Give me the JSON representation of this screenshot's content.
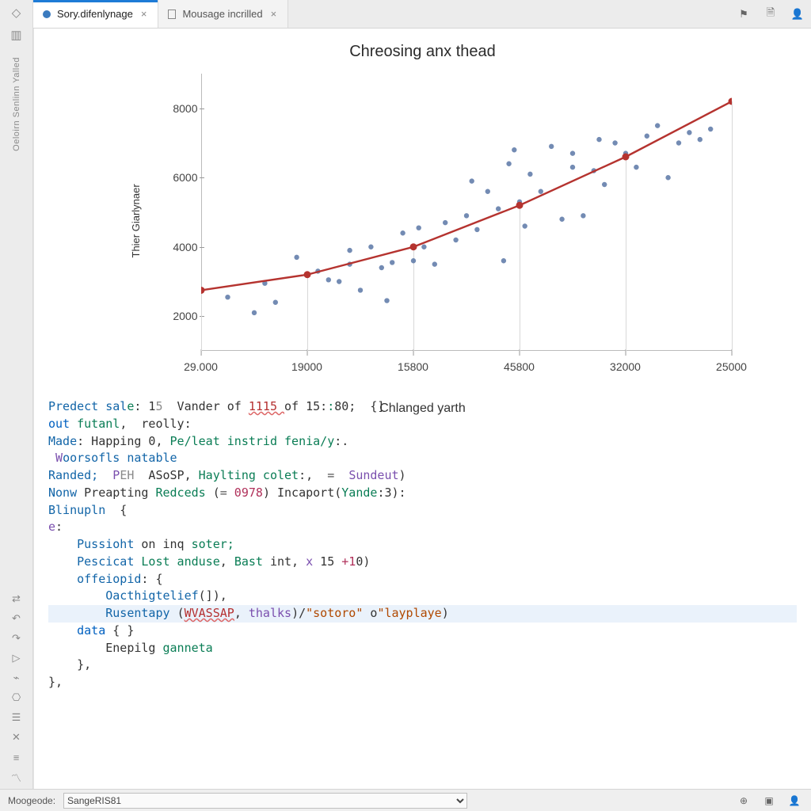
{
  "tabs": [
    {
      "label": "Sory.difenlynage",
      "icon": "dot",
      "active": true
    },
    {
      "label": "Mousage incrilled",
      "icon": "doc",
      "active": false
    }
  ],
  "toolbar_icons": [
    "pin-icon",
    "new-file-icon",
    "user-icon"
  ],
  "gutter": {
    "top_icons": [
      "diamond-icon",
      "layout-icon"
    ],
    "vertical_label": "Oeloirn Senlinn Yalled",
    "bottom_icons": [
      "swap-icon",
      "undo-icon",
      "redo-icon",
      "play-icon",
      "brackets-icon",
      "code-icon",
      "db-icon",
      "close-icon",
      "list-icon",
      "chart-icon",
      "grid-icon"
    ]
  },
  "chart_data": {
    "type": "scatter",
    "title": "Chreosing anx thead",
    "xlabel": "Chlanged yarth",
    "ylabel": "Thier Giarlynaer",
    "ylim": [
      1000,
      9000
    ],
    "yticks": [
      2000,
      4000,
      6000,
      8000
    ],
    "x_categories": [
      "29.000",
      "19000",
      "15800",
      "45800",
      "32000",
      "25000"
    ],
    "series": [
      {
        "name": "scatter",
        "color": "#5b77a6",
        "points": [
          {
            "xi": 0.05,
            "y": 2550
          },
          {
            "xi": 0.1,
            "y": 2100
          },
          {
            "xi": 0.12,
            "y": 2950
          },
          {
            "xi": 0.14,
            "y": 2400
          },
          {
            "xi": 0.18,
            "y": 3700
          },
          {
            "xi": 0.22,
            "y": 3300
          },
          {
            "xi": 0.24,
            "y": 3050
          },
          {
            "xi": 0.26,
            "y": 3000
          },
          {
            "xi": 0.28,
            "y": 3500
          },
          {
            "xi": 0.28,
            "y": 3900
          },
          {
            "xi": 0.3,
            "y": 2750
          },
          {
            "xi": 0.32,
            "y": 4000
          },
          {
            "xi": 0.34,
            "y": 3400
          },
          {
            "xi": 0.35,
            "y": 2450
          },
          {
            "xi": 0.36,
            "y": 3550
          },
          {
            "xi": 0.38,
            "y": 4400
          },
          {
            "xi": 0.4,
            "y": 3600
          },
          {
            "xi": 0.41,
            "y": 4550
          },
          {
            "xi": 0.42,
            "y": 4000
          },
          {
            "xi": 0.44,
            "y": 3500
          },
          {
            "xi": 0.46,
            "y": 4700
          },
          {
            "xi": 0.48,
            "y": 4200
          },
          {
            "xi": 0.5,
            "y": 4900
          },
          {
            "xi": 0.51,
            "y": 5900
          },
          {
            "xi": 0.52,
            "y": 4500
          },
          {
            "xi": 0.54,
            "y": 5600
          },
          {
            "xi": 0.56,
            "y": 5100
          },
          {
            "xi": 0.57,
            "y": 3600
          },
          {
            "xi": 0.58,
            "y": 6400
          },
          {
            "xi": 0.59,
            "y": 6800
          },
          {
            "xi": 0.6,
            "y": 5300
          },
          {
            "xi": 0.61,
            "y": 4600
          },
          {
            "xi": 0.62,
            "y": 6100
          },
          {
            "xi": 0.64,
            "y": 5600
          },
          {
            "xi": 0.66,
            "y": 6900
          },
          {
            "xi": 0.68,
            "y": 4800
          },
          {
            "xi": 0.7,
            "y": 6300
          },
          {
            "xi": 0.7,
            "y": 6700
          },
          {
            "xi": 0.72,
            "y": 4900
          },
          {
            "xi": 0.74,
            "y": 6200
          },
          {
            "xi": 0.75,
            "y": 7100
          },
          {
            "xi": 0.76,
            "y": 5800
          },
          {
            "xi": 0.78,
            "y": 7000
          },
          {
            "xi": 0.8,
            "y": 6700
          },
          {
            "xi": 0.82,
            "y": 6300
          },
          {
            "xi": 0.84,
            "y": 7200
          },
          {
            "xi": 0.86,
            "y": 7500
          },
          {
            "xi": 0.88,
            "y": 6000
          },
          {
            "xi": 0.9,
            "y": 7000
          },
          {
            "xi": 0.92,
            "y": 7300
          },
          {
            "xi": 0.94,
            "y": 7100
          },
          {
            "xi": 0.96,
            "y": 7400
          }
        ]
      },
      {
        "name": "fit",
        "color": "#b5332f",
        "line": [
          {
            "xi": 0.0,
            "y": 2750
          },
          {
            "xi": 0.2,
            "y": 3200
          },
          {
            "xi": 0.4,
            "y": 4000
          },
          {
            "xi": 0.6,
            "y": 5200
          },
          {
            "xi": 0.8,
            "y": 6600
          },
          {
            "xi": 1.0,
            "y": 8200
          }
        ],
        "markers": [
          {
            "xi": 0.0,
            "y": 2750
          },
          {
            "xi": 0.2,
            "y": 3200
          },
          {
            "xi": 0.4,
            "y": 4000
          },
          {
            "xi": 0.6,
            "y": 5200
          },
          {
            "xi": 0.8,
            "y": 6600
          },
          {
            "xi": 1.0,
            "y": 8200
          }
        ]
      }
    ]
  },
  "code": {
    "lines": [
      {
        "frags": [
          {
            "t": "Predect sal",
            "c": "id"
          },
          {
            "t": "e",
            "c": "nm"
          },
          {
            "t": ": 1",
            "c": ""
          },
          {
            "t": "5",
            "c": "cm"
          },
          {
            "t": "  Vander of ",
            "c": ""
          },
          {
            "t": "1115 ",
            "c": "err"
          },
          {
            "t": "of 15:",
            "c": ""
          },
          {
            "t": ":",
            "c": "nm"
          },
          {
            "t": "80;  {]",
            "c": ""
          }
        ]
      },
      {
        "frags": [
          {
            "t": "out ",
            "c": "kw"
          },
          {
            "t": "futanl",
            "c": "nm"
          },
          {
            "t": ",  reolly:",
            "c": ""
          }
        ]
      },
      {
        "frags": [
          {
            "t": "Made",
            "c": "id"
          },
          {
            "t": ": Happing 0, ",
            "c": ""
          },
          {
            "t": "Pe/leat instrid fenia/y",
            "c": "nm"
          },
          {
            "t": ":.",
            "c": ""
          }
        ]
      },
      {
        "frags": [
          {
            "t": " W",
            "c": "fn"
          },
          {
            "t": "oorsofls natable",
            "c": "id"
          }
        ]
      },
      {
        "frags": [
          {
            "t": "",
            "c": ""
          }
        ]
      },
      {
        "frags": [
          {
            "t": "Randed;  ",
            "c": "id"
          },
          {
            "t": "P",
            "c": "fn"
          },
          {
            "t": "EH",
            "c": "cm"
          },
          {
            "t": "  ASoSP, ",
            "c": ""
          },
          {
            "t": "Haylting colet",
            "c": "nm"
          },
          {
            "t": ":,  ",
            "c": ""
          },
          {
            "t": "=",
            "c": "op"
          },
          {
            "t": "  ",
            "c": ""
          },
          {
            "t": "Sundeut",
            "c": "fn"
          },
          {
            "t": ")",
            "c": ""
          }
        ]
      },
      {
        "frags": [
          {
            "t": "Nonw ",
            "c": "id"
          },
          {
            "t": "Preapting ",
            "c": ""
          },
          {
            "t": "Redceds",
            "c": "nm"
          },
          {
            "t": " (",
            "c": ""
          },
          {
            "t": "=",
            "c": "op"
          },
          {
            "t": " 0978",
            "c": "num"
          },
          {
            "t": ") Incaport(",
            "c": ""
          },
          {
            "t": "Yande",
            "c": "nm"
          },
          {
            "t": ":3):",
            "c": ""
          }
        ]
      },
      {
        "frags": [
          {
            "t": "Blinupln",
            "c": "id"
          },
          {
            "t": "  {",
            "c": ""
          }
        ]
      },
      {
        "frags": [
          {
            "t": "e",
            "c": "fn"
          },
          {
            "t": ":",
            "c": ""
          }
        ]
      },
      {
        "frags": [
          {
            "t": "    ",
            "c": ""
          },
          {
            "t": "Pussioht ",
            "c": "id"
          },
          {
            "t": "on inq ",
            "c": ""
          },
          {
            "t": "soter;",
            "c": "nm"
          }
        ]
      },
      {
        "frags": [
          {
            "t": "    ",
            "c": ""
          },
          {
            "t": "Pescicat ",
            "c": "id"
          },
          {
            "t": "Lost anduse",
            "c": "nm"
          },
          {
            "t": ", ",
            "c": ""
          },
          {
            "t": "Bast ",
            "c": "nm"
          },
          {
            "t": "int, ",
            "c": ""
          },
          {
            "t": "x",
            "c": "fn"
          },
          {
            "t": " 15 ",
            "c": ""
          },
          {
            "t": "+1",
            "c": "num"
          },
          {
            "t": "0)",
            "c": ""
          }
        ]
      },
      {
        "frags": [
          {
            "t": "    ",
            "c": ""
          },
          {
            "t": "offeiopid",
            "c": "id"
          },
          {
            "t": ": {",
            "c": ""
          }
        ]
      },
      {
        "frags": [
          {
            "t": "        ",
            "c": ""
          },
          {
            "t": "Oacthigtelief",
            "c": "id"
          },
          {
            "t": "(]),",
            "c": ""
          }
        ]
      },
      {
        "hl": true,
        "frags": [
          {
            "t": "        ",
            "c": ""
          },
          {
            "t": "Rusentapy ",
            "c": "id"
          },
          {
            "t": "(",
            "c": ""
          },
          {
            "t": "WVASSAP",
            "c": "err"
          },
          {
            "t": ", ",
            "c": ""
          },
          {
            "t": "thalks",
            "c": "fn"
          },
          {
            "t": ")/",
            "c": ""
          },
          {
            "t": "\"sotoro\"",
            "c": "str"
          },
          {
            "t": " o",
            "c": ""
          },
          {
            "t": "\"layplaye",
            "c": "str"
          },
          {
            "t": ")",
            "c": ""
          }
        ]
      },
      {
        "frags": [
          {
            "t": "    ",
            "c": ""
          },
          {
            "t": "data ",
            "c": "kw"
          },
          {
            "t": "{ }",
            "c": ""
          }
        ]
      },
      {
        "frags": [
          {
            "t": "        Enepilg ",
            "c": ""
          },
          {
            "t": "ganneta",
            "c": "nm"
          }
        ]
      },
      {
        "frags": [
          {
            "t": "    },",
            "c": ""
          }
        ]
      },
      {
        "frags": [
          {
            "t": "},",
            "c": ""
          }
        ]
      }
    ]
  },
  "status": {
    "label": "Moogeode:",
    "selected": "SangeRIS81",
    "icons": [
      "target-icon",
      "panel-icon",
      "user-icon"
    ]
  }
}
